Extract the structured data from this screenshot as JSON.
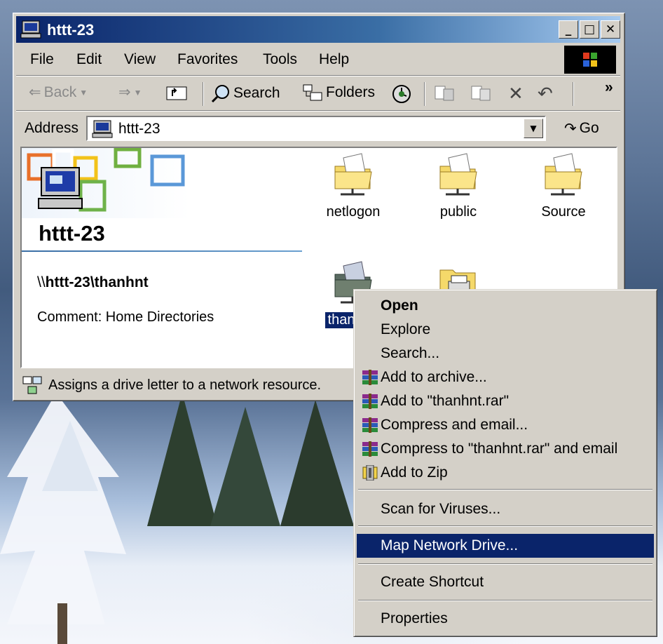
{
  "window": {
    "title": "httt-23",
    "menu": [
      "File",
      "Edit",
      "View",
      "Favorites",
      "Tools",
      "Help"
    ],
    "toolbar": {
      "back": "Back",
      "search": "Search",
      "folders": "Folders",
      "more": "»"
    },
    "address": {
      "label": "Address",
      "value": "httt-23",
      "go": "Go"
    },
    "panel": {
      "title": "httt-23",
      "path_prefix": "\\\\",
      "path_main": "httt-23\\thanhnt",
      "comment": "Comment: Home Directories"
    },
    "folders": [
      {
        "label": "netlogon",
        "icon": "shared-folder-icon"
      },
      {
        "label": "public",
        "icon": "shared-folder-icon"
      },
      {
        "label": "Source",
        "icon": "shared-folder-icon"
      },
      {
        "label": "than",
        "icon": "shared-folder-icon",
        "selected": true
      },
      {
        "label": "",
        "icon": "printer-folder-icon"
      }
    ],
    "status": "Assigns a drive letter to a network resource."
  },
  "context_menu": {
    "items": [
      {
        "label": "Open",
        "bold": true
      },
      {
        "label": "Explore"
      },
      {
        "label": "Search..."
      },
      {
        "label": "Add to archive...",
        "icon": "winrar-icon"
      },
      {
        "label": "Add to \"thanhnt.rar\"",
        "icon": "winrar-icon"
      },
      {
        "label": "Compress and email...",
        "icon": "winrar-icon"
      },
      {
        "label": "Compress to \"thanhnt.rar\" and email",
        "icon": "winrar-icon"
      },
      {
        "label": "Add to Zip",
        "icon": "winzip-icon"
      },
      {
        "label": "Scan for Viruses..."
      },
      {
        "label": "Map Network Drive...",
        "highlighted": true
      },
      {
        "label": "Create Shortcut"
      },
      {
        "label": "Properties"
      }
    ]
  },
  "colors": {
    "titlebar_start": "#0a246a",
    "titlebar_end": "#a6caf0",
    "selection": "#0a246a",
    "face": "#d4d0c8"
  }
}
